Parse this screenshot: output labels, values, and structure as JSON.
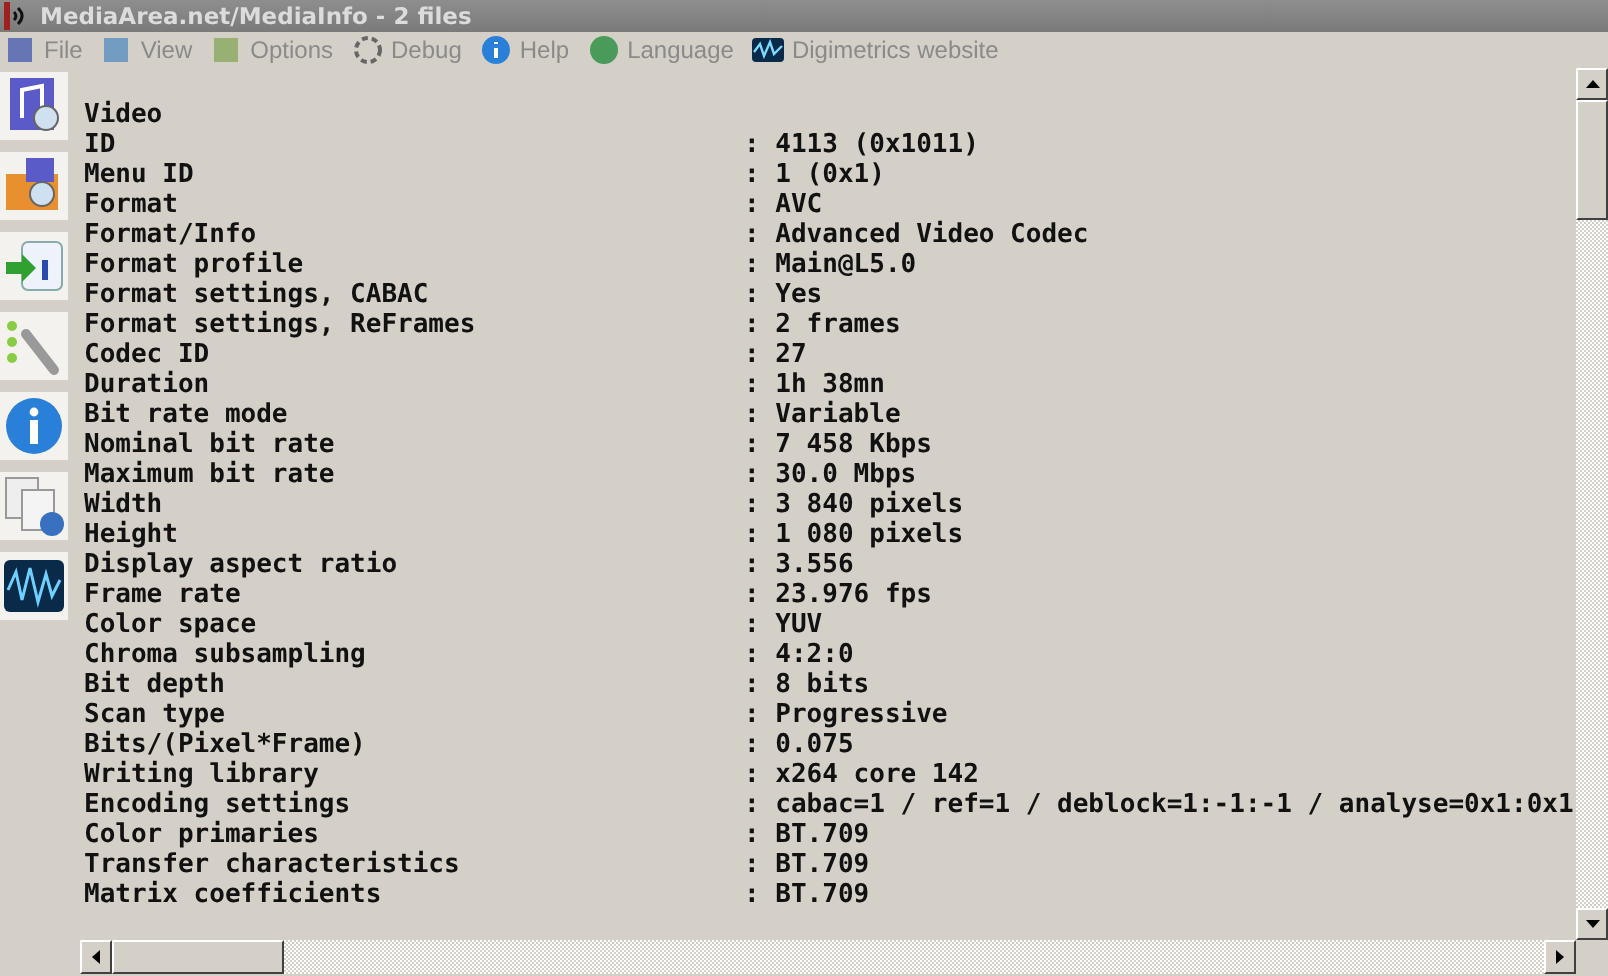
{
  "window": {
    "title": "MediaArea.net/MediaInfo - 2 files"
  },
  "menu": [
    {
      "label": "File"
    },
    {
      "label": "View"
    },
    {
      "label": "Options"
    },
    {
      "label": "Debug"
    },
    {
      "label": "Help"
    },
    {
      "label": "Language"
    },
    {
      "label": "Digimetrics website"
    }
  ],
  "section": {
    "title": "Video"
  },
  "fields": [
    {
      "label": "ID",
      "value": ": 4113 (0x1011)"
    },
    {
      "label": "Menu ID",
      "value": ": 1 (0x1)"
    },
    {
      "label": "Format",
      "value": ": AVC"
    },
    {
      "label": "Format/Info",
      "value": ": Advanced Video Codec"
    },
    {
      "label": "Format profile",
      "value": ": Main@L5.0"
    },
    {
      "label": "Format settings, CABAC",
      "value": ": Yes"
    },
    {
      "label": "Format settings, ReFrames",
      "value": ": 2 frames"
    },
    {
      "label": "Codec ID",
      "value": ": 27"
    },
    {
      "label": "Duration",
      "value": ": 1h 38mn"
    },
    {
      "label": "Bit rate mode",
      "value": ": Variable"
    },
    {
      "label": "Nominal bit rate",
      "value": ": 7 458 Kbps"
    },
    {
      "label": "Maximum bit rate",
      "value": ": 30.0 Mbps"
    },
    {
      "label": "Width",
      "value": ": 3 840 pixels"
    },
    {
      "label": "Height",
      "value": ": 1 080 pixels"
    },
    {
      "label": "Display aspect ratio",
      "value": ": 3.556"
    },
    {
      "label": "Frame rate",
      "value": ": 23.976 fps"
    },
    {
      "label": "Color space",
      "value": ": YUV"
    },
    {
      "label": "Chroma subsampling",
      "value": ": 4:2:0"
    },
    {
      "label": "Bit depth",
      "value": ": 8 bits"
    },
    {
      "label": "Scan type",
      "value": ": Progressive"
    },
    {
      "label": "Bits/(Pixel*Frame)",
      "value": ": 0.075"
    },
    {
      "label": "Writing library",
      "value": ": x264 core 142"
    },
    {
      "label": "Encoding settings",
      "value": ": cabac=1 / ref=1 / deblock=1:-1:-1 / analyse=0x1:0x1"
    },
    {
      "label": "Color primaries",
      "value": ": BT.709"
    },
    {
      "label": "Transfer characteristics",
      "value": ": BT.709"
    },
    {
      "label": "Matrix coefficients",
      "value": ": BT.709"
    }
  ]
}
